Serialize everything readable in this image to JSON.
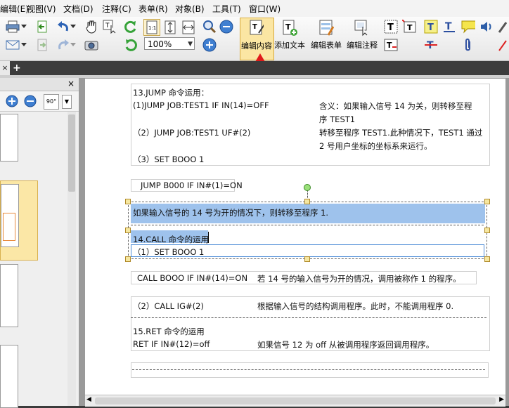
{
  "menu": [
    "编辑(E)",
    "视图(V)",
    "文档(D)",
    "注释(C)",
    "表单(R)",
    "对象(B)",
    "工具(T)",
    "窗口(W)"
  ],
  "toolbar": {
    "zoom_value": "100%",
    "edit_content": "编辑内容",
    "add_text": "添加文本",
    "edit_form": "编辑表单",
    "edit_annotation": "编辑注释"
  },
  "panel": {
    "close": "×",
    "rotate": "90°"
  },
  "tabs": {
    "close": "×",
    "add": "+"
  },
  "doc": {
    "s13_title": "13.JUMP 命令运用：",
    "s13_l1": "(1)JUMP JOB:TEST1 IF IN(14)=OFF",
    "s13_r1a": "含义：如果输入信号 14 为关，则转移至程",
    "s13_r1b": "序 TEST1",
    "s13_l2": "（2）JUMP JOB:TEST1 UF#(2)",
    "s13_r2a": "转移至程序 TEST1.此种情况下，TEST1 通过",
    "s13_r2b": "2 号用户坐标的坐标系来运行。",
    "s13_l3": "（3）SET BOOO 1",
    "jump_line": "JUMP B000 IF IN#(1)=ON",
    "sel_line1": "如果输入信号的 14 号为开的情况下，则转移至程序 1.",
    "sel_line2": "14.CALL 命令的运用",
    "sel_line3": "（1）SET BOOO 1",
    "call_l": "CALL BOOO IF IN#(14)=ON",
    "call_r": "若 14 号的输入信号为开的情况，调用被称作 1 的程序。",
    "call2_l": "（2）CALL IG#(2)",
    "call2_r": "根据输入信号的结构调用程序。此时，不能调用程序 0.",
    "s15_title": "15.RET 命令的运用",
    "s15_l": "RET IF IN#(12)=off",
    "s15_r": "如果信号 12 为 off  从被调用程序返回调用程序。"
  },
  "colors": {
    "selection": "#9ec2ec",
    "arrow": "#e01a1a",
    "active_button": "#fbe6a3"
  }
}
